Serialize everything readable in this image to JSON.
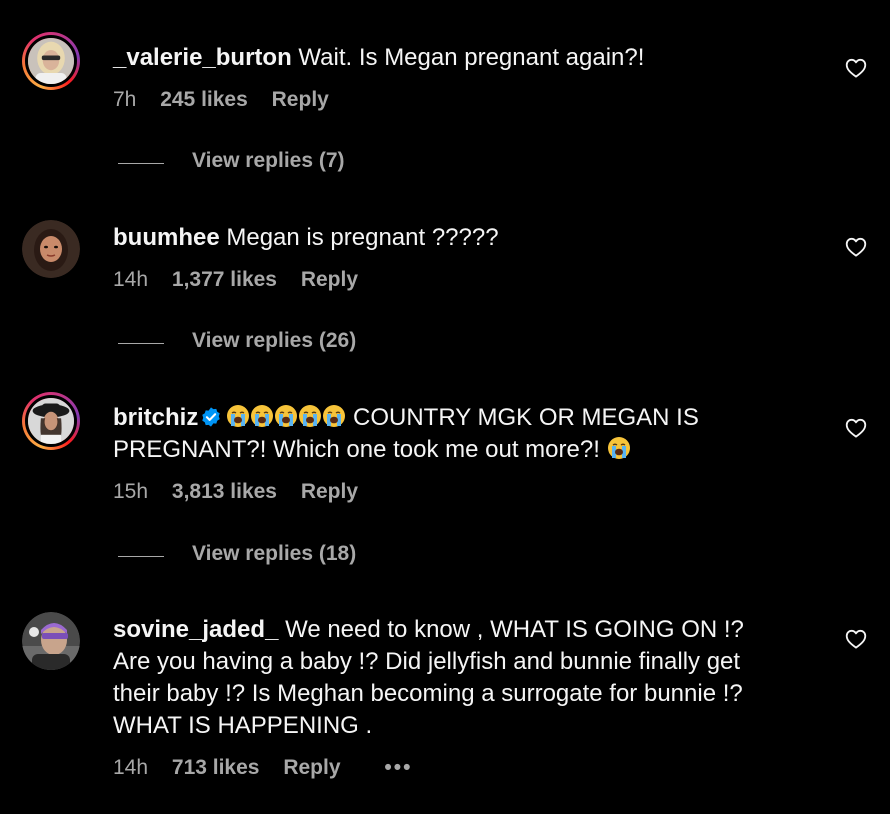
{
  "comments": [
    {
      "username": "_valerie_burton",
      "text": "Wait. Is Megan pregnant again?!",
      "time": "7h",
      "likes": "245 likes",
      "reply_label": "Reply",
      "view_replies": "View replies (7)",
      "avatar_ring": true
    },
    {
      "username": "buumhee",
      "text": "Megan is pregnant ?????",
      "time": "14h",
      "likes": "1,377 likes",
      "reply_label": "Reply",
      "view_replies": "View replies (26)",
      "avatar_ring": false
    },
    {
      "username": "britchiz",
      "verified": true,
      "text_line1": "COUNTRY MGK OR MEGAN IS",
      "text_line2": "PREGNANT?! Which one took me out more?!",
      "emoji_lead": "loudly-crying-face x5",
      "emoji_tail": "loudly-crying-face",
      "time": "15h",
      "likes": "3,813 likes",
      "reply_label": "Reply",
      "view_replies": "View replies (18)",
      "avatar_ring": true
    },
    {
      "username": "sovine_jaded_",
      "text_line1": "We need to know , WHAT IS GOING ON !?",
      "text_line2": "Are you having a baby !? Did jellyfish and bunnie finally get",
      "text_line3": "their baby !? Is Meghan becoming a surrogate for bunnie !?",
      "text_line4": "WHAT IS HAPPENING .",
      "time": "14h",
      "likes": "713 likes",
      "reply_label": "Reply",
      "more_label": "•••",
      "avatar_ring": false
    }
  ],
  "icons": {
    "like": "heart-outline-icon",
    "verified": "verified-badge-icon",
    "emoji": "loudly-crying-face-emoji"
  },
  "colors": {
    "background": "#000000",
    "text": "#f5f5f5",
    "secondary": "#a8a8a8",
    "verified": "#0095f6"
  }
}
